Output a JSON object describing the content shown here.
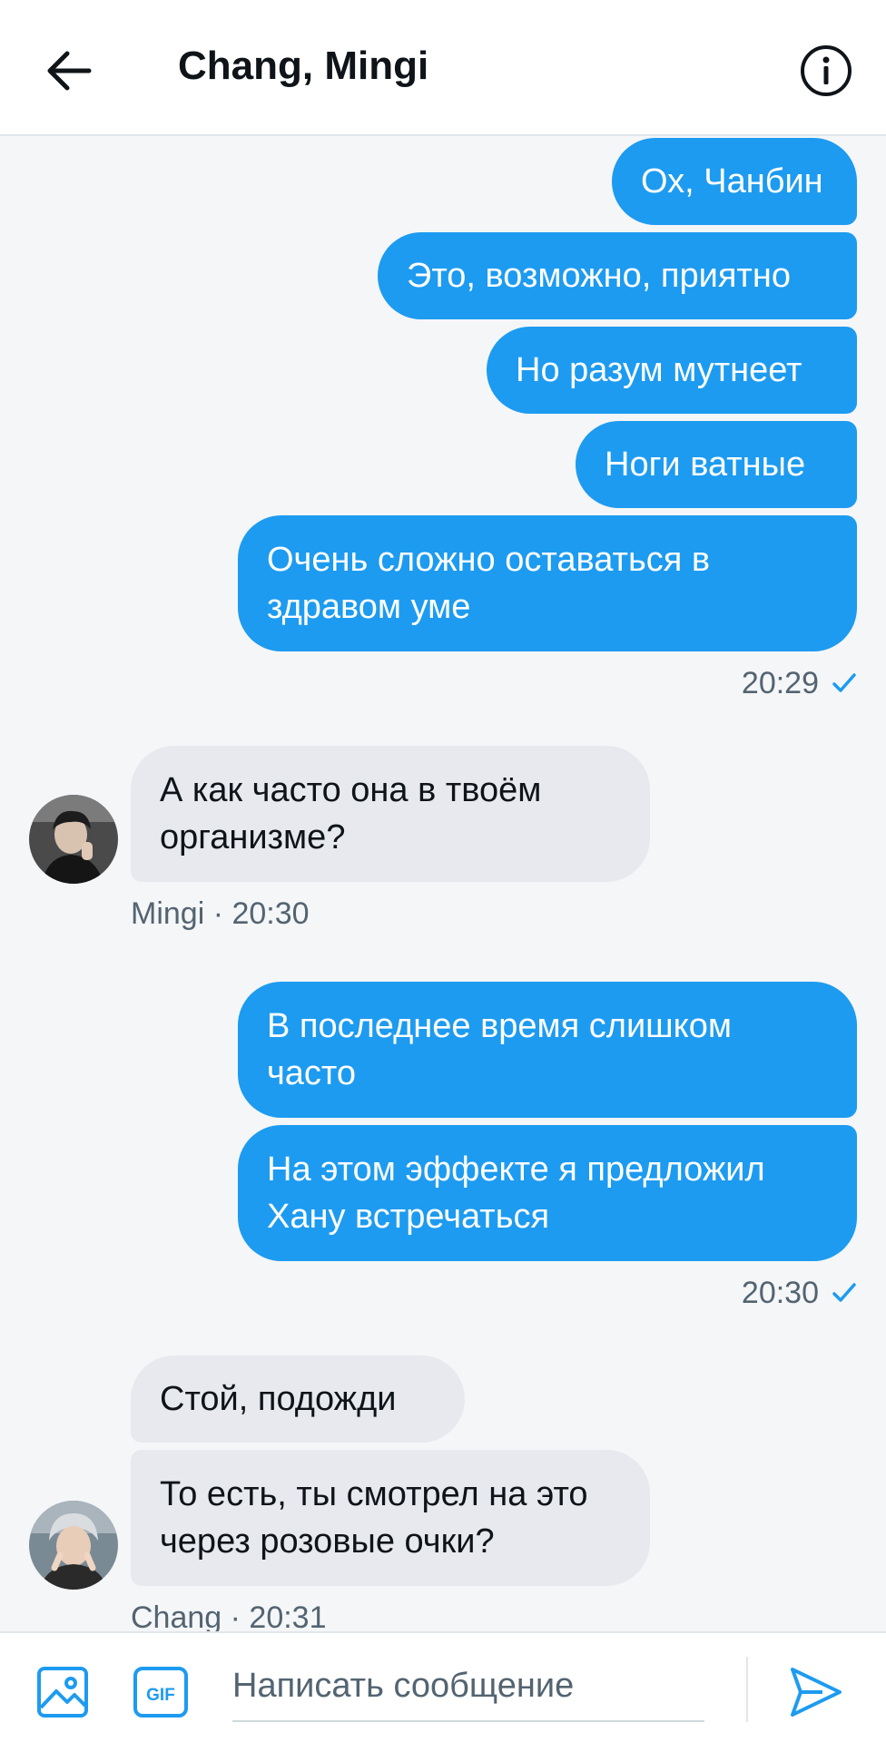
{
  "header": {
    "title": "Chang, Mingi",
    "back_icon": "arrow-left-icon",
    "info_icon": "info-icon"
  },
  "messages": {
    "m1": "Ох, Чанбин",
    "m2": "Это, возможно, приятно",
    "m3": "Но разум мутнеет",
    "m4": "Ноги ватные",
    "m5": "Очень сложно оставаться в здравом уме",
    "t1": "20:29",
    "m6": "А как часто она в твоём организме?",
    "t2": "Mingi · 20:30",
    "m7": "В последнее время слишком часто",
    "m8": "На этом эффекте я предложил Хану встречаться",
    "t3": "20:30",
    "m9": "Стой, подожди",
    "m10": "То есть, ты смотрел на это через розовые очки?",
    "t4": "Chang · 20:31"
  },
  "composer": {
    "placeholder": "Написать сообщение",
    "gif_label": "GIF"
  },
  "colors": {
    "accent": "#1d9bf0",
    "incoming_bg": "#e7e9ef",
    "meta": "#536471"
  }
}
